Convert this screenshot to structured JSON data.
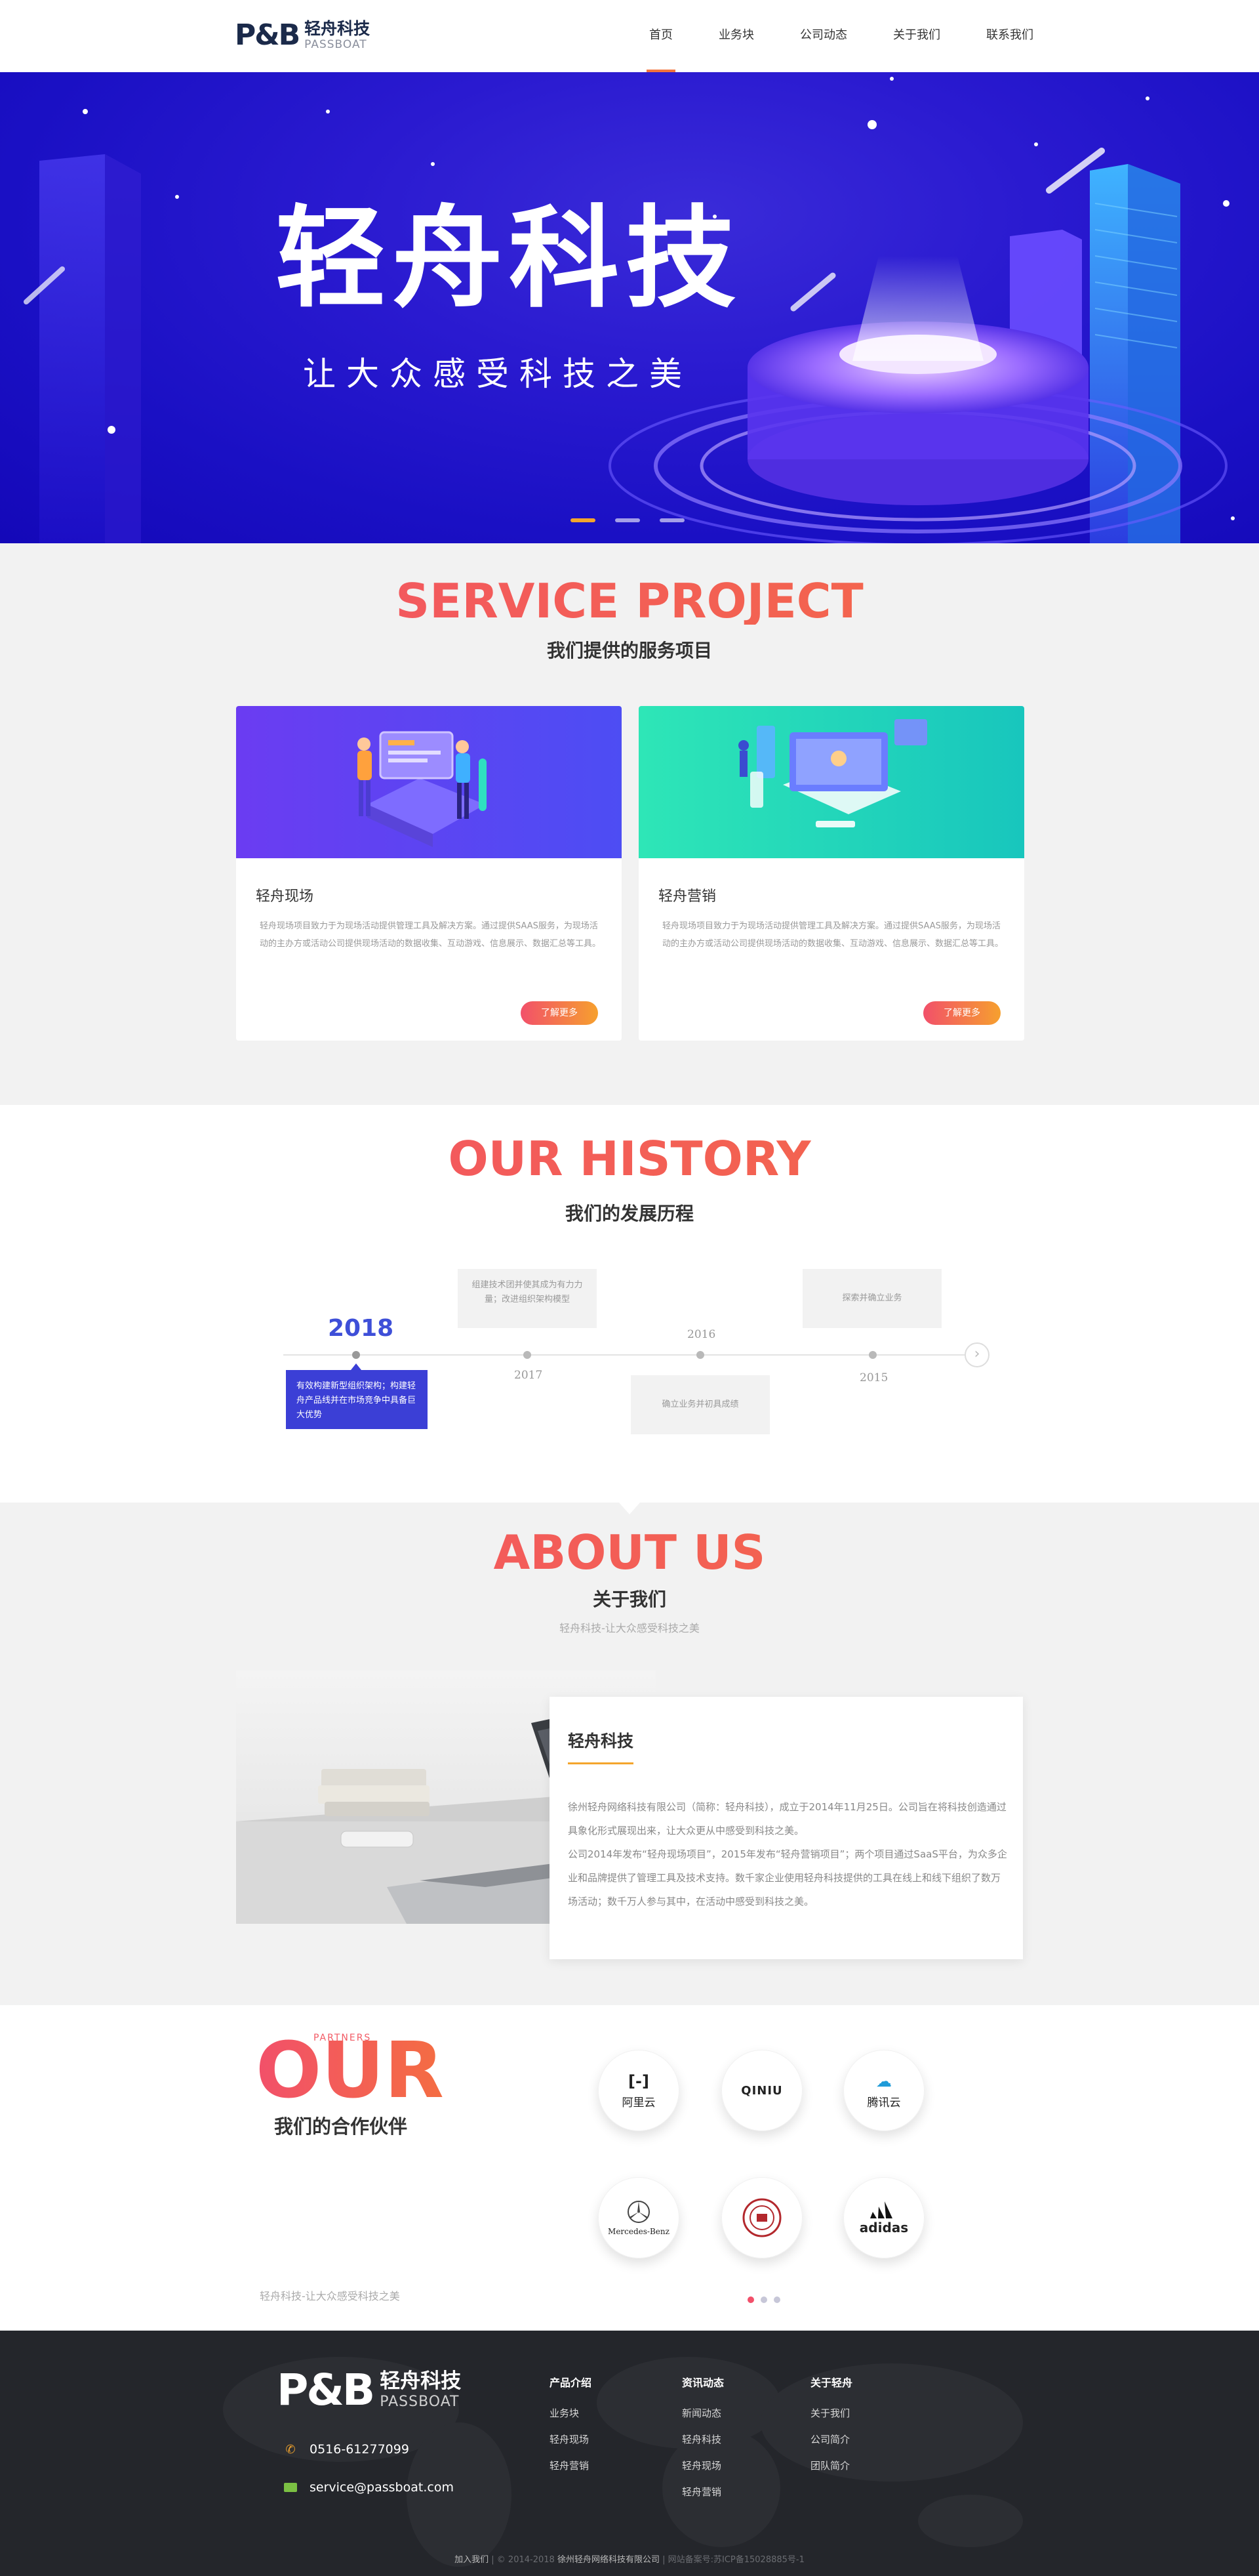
{
  "header": {
    "logo_mark": "P&B",
    "logo_cn": "轻舟科技",
    "logo_en": "PASSBOAT",
    "nav": [
      "首页",
      "业务块",
      "公司动态",
      "关于我们",
      "联系我们"
    ],
    "active_nav": 0
  },
  "hero": {
    "title": "轻舟科技",
    "subtitle": "让大众感受科技之美",
    "slides": 3,
    "active_slide": 0
  },
  "services": {
    "title": "SERVICE PROJECT",
    "subtitle": "我们提供的服务项目",
    "cards": [
      {
        "name": "轻舟现场",
        "desc": "轻舟现场项目致力于为现场活动提供管理工具及解决方案。通过提供SAAS服务，为现场活动的主办方或活动公司提供现场活动的数据收集、互动游戏、信息展示、数据汇总等工具。",
        "button": "了解更多"
      },
      {
        "name": "轻舟营销",
        "desc": "轻舟现场项目致力于为现场活动提供管理工具及解决方案。通过提供SAAS服务，为现场活动的主办方或活动公司提供现场活动的数据收集、互动游戏、信息展示、数据汇总等工具。",
        "button": "了解更多"
      }
    ]
  },
  "history": {
    "title": "OUR HISTORY",
    "subtitle": "我们的发展历程",
    "events": [
      {
        "year": "2018",
        "text": "有效构建新型组织架构；构建轻舟产品线并在市场竞争中具备巨大优势"
      },
      {
        "year": "2017",
        "text": "组建技术团并使其成为有力力量；改进组织架构模型"
      },
      {
        "year": "2016",
        "text": "确立业务并初具成绩"
      },
      {
        "year": "2015",
        "text": "探索并确立业务"
      }
    ],
    "next_icon": "chevron-right-icon"
  },
  "about": {
    "title": "ABOUT US",
    "subtitle": "关于我们",
    "tagline": "轻舟科技-让大众感受科技之美",
    "card_title": "轻舟科技",
    "paragraphs": [
      "徐州轻舟网络科技有限公司（简称：轻舟科技），成立于2014年11月25日。公司旨在将科技创造通过具象化形式展现出来，让大众更从中感受到科技之美。",
      "公司2014年发布“轻舟现场项目”，2015年发布“轻舟营销项目”；两个项目通过SaaS平台，为众多企业和品牌提供了管理工具及技术支持。数千家企业使用轻舟科技提供的工具在线上和线下组织了数万场活动；数千万人参与其中，在活动中感受到科技之美。"
    ]
  },
  "partners": {
    "title": "OUR",
    "small": "PARTNERS",
    "subtitle": "我们的合作伙伴",
    "tagline": "轻舟科技-让大众感受科技之美",
    "logos": [
      {
        "name": "阿里云",
        "icon": "aliyun-icon"
      },
      {
        "name": "QINIU",
        "icon": "qiniu-icon"
      },
      {
        "name": "腾讯云",
        "icon": "tencent-cloud-icon"
      },
      {
        "name": "Mercedes-Benz",
        "icon": "mercedes-icon"
      },
      {
        "name": "北京大学",
        "icon": "pku-seal-icon"
      },
      {
        "name": "adidas",
        "icon": "adidas-icon"
      }
    ],
    "pages": 3,
    "active_page": 0
  },
  "footer": {
    "logo_mark": "P&B",
    "logo_cn": "轻舟科技",
    "logo_en": "PASSBOAT",
    "phone": "0516-61277099",
    "email": "service@passboat.com",
    "columns": [
      {
        "head": "产品介绍",
        "items": [
          "业务块",
          "轻舟现场",
          "轻舟营销"
        ]
      },
      {
        "head": "资讯动态",
        "items": [
          "新闻动态",
          "轻舟科技",
          "轻舟现场",
          "轻舟营销"
        ]
      },
      {
        "head": "关于轻舟",
        "items": [
          "关于我们",
          "公司简介",
          "团队简介"
        ]
      }
    ],
    "bottom_join": "加入我们",
    "bottom_copy": "© 2014-2018",
    "bottom_company": "徐州轻舟网络科技有限公司",
    "bottom_icp": "网站备案号:苏ICP备15028885号-1"
  },
  "colors": {
    "accent_orange": "#f3743c",
    "accent_gradient_start": "#f2506a",
    "accent_gradient_end": "#f46d42",
    "hero_blue": "#1a10c4",
    "timeline_active": "#3b3fd6",
    "footer_bg": "#24262b"
  }
}
